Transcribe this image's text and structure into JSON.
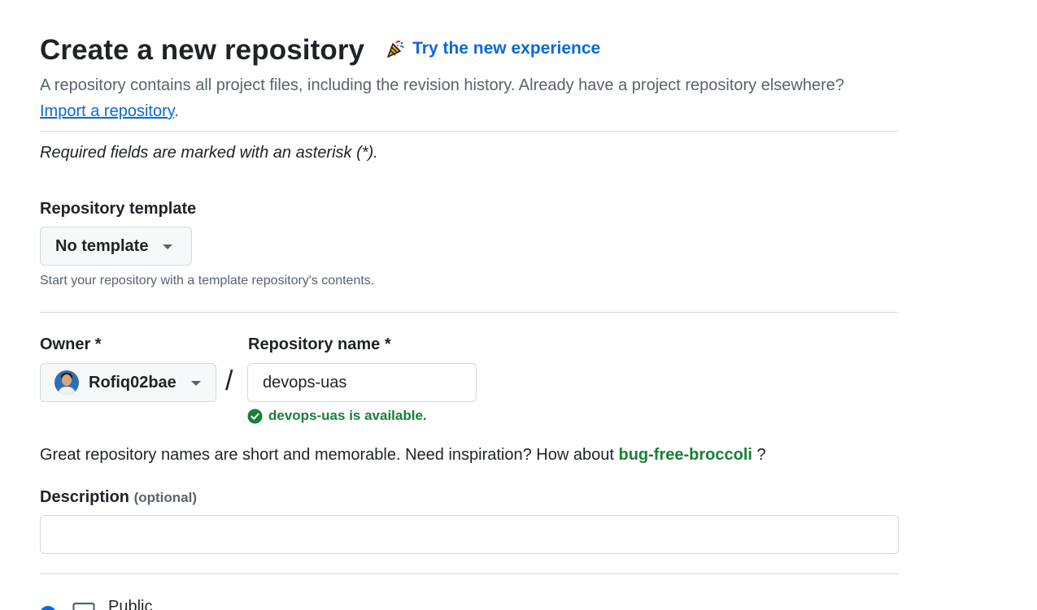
{
  "header": {
    "title": "Create a new repository",
    "try_new_label": "Try the new experience",
    "try_new_icon": "party-popper-icon",
    "subtitle_text": "A repository contains all project files, including the revision history. Already have a project repository elsewhere?",
    "import_link": "Import a repository",
    "import_suffix": "."
  },
  "required_note": "Required fields are marked with an asterisk (*).",
  "template": {
    "label": "Repository template",
    "selected": "No template",
    "hint": "Start your repository with a template repository's contents."
  },
  "owner": {
    "label": "Owner *",
    "selected": "Rofiq02bae",
    "avatar_icon": "user-avatar"
  },
  "separator": "/",
  "repo_name": {
    "label": "Repository name *",
    "value": "devops-uas",
    "availability": "devops-uas is available."
  },
  "suggestion": {
    "text": "Great repository names are short and memorable. Need inspiration? How about",
    "name": "bug-free-broccoli",
    "suffix": "?"
  },
  "description": {
    "label": "Description",
    "optional": "(optional)",
    "value": ""
  },
  "visibility": {
    "public_label": "Public"
  },
  "colors": {
    "link": "#0969da",
    "success": "#1a7f37",
    "muted": "#59636e",
    "border": "#d1d9e0"
  }
}
